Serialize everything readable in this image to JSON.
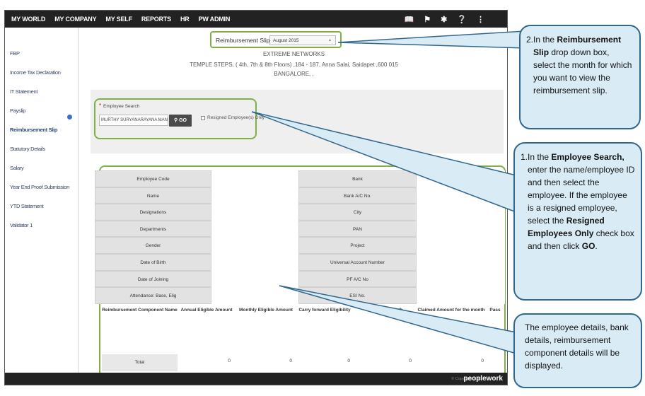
{
  "nav": [
    "MY WORLD",
    "MY COMPANY",
    "MY SELF",
    "REPORTS",
    "HR",
    "PW ADMIN"
  ],
  "nav_icons": [
    "book-icon",
    "flag-icon",
    "star-icon",
    "help-icon",
    "share-icon"
  ],
  "sidebar": [
    "FBP",
    "Income Tax Declaration",
    "IT Statement",
    "Payslip",
    "Reimbursement Slip",
    "Statutory Details",
    "Salary",
    "Year End Proof Submission",
    "YTD Statement",
    "Validator 1"
  ],
  "slip": {
    "label": "Reimbursement Slip",
    "month": "August 2015"
  },
  "company": {
    "name": "EXTREME NETWORKS",
    "address": "TEMPLE STEPS, ( 4th, 7th & 8th Floors) ,184 - 187, Anna Salai, Saidapet ,600 015",
    "city": "BANGALORE, ,"
  },
  "search": {
    "label": "Employee Search",
    "value": "MURTHY SURYANARAYANA MAN",
    "go": "GO",
    "resigned_label": "Resigned Employee(s) Only"
  },
  "details_left": [
    "Employee Code",
    "Name",
    "Designations",
    "Departments",
    "Gender",
    "Date of Birth",
    "Date of Joining",
    "Attendance: Base, Elig"
  ],
  "details_right": [
    "Bank",
    "Bank A/C No.",
    "City",
    "PAN",
    "Project",
    "Universal Account Number",
    "PF A/C No",
    "ESI No."
  ],
  "columns": [
    "Reimbursement Component Name",
    "Annual Eligible Amount",
    "Monthly Eligible Amount",
    "Carry forward Eligibility",
    "Previous Month",
    "Claimed Amount for the month",
    "Pass"
  ],
  "total": {
    "label": "Total",
    "values": [
      "0",
      "0",
      "0",
      "0",
      "0"
    ]
  },
  "footer": {
    "copyright": "© Copyright 2015",
    "brand": "peoplework"
  },
  "callouts": {
    "c2": {
      "num": "2.",
      "t1": "In the ",
      "b1": "Reimbursement Slip",
      "t2": " drop down box, select the month for which you want to view the reimbursement slip."
    },
    "c1": {
      "num": "1.",
      "t1": "In the ",
      "b1": "Employee Search,",
      "t2": " enter the name/employee ID and then select the employee. If the employee is a resigned employee, select the ",
      "b2": "Resigned Employees Only",
      "t3": " check box and then click ",
      "b3": "GO",
      "t4": "."
    },
    "c3": {
      "text": "The employee details, bank details, reimbursement component details will be displayed."
    }
  },
  "colors": {
    "accent": "#7fb045",
    "callout_bg": "#d9ecf5",
    "callout_border": "#31678c",
    "nav_bg": "#222222"
  }
}
